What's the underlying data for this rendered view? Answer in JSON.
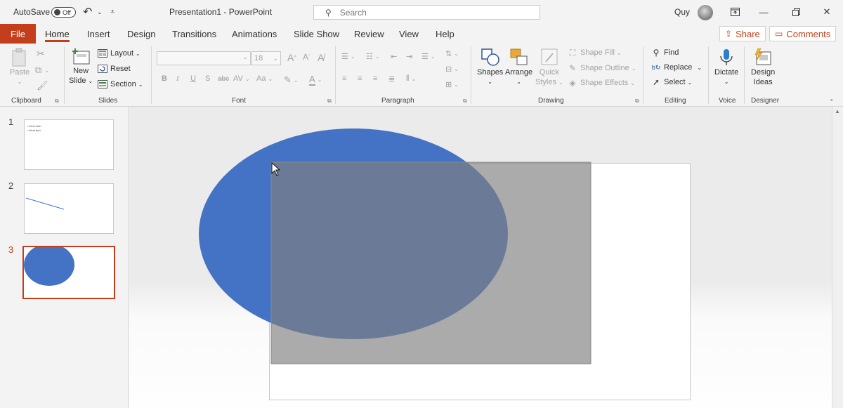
{
  "titlebar": {
    "autosave_label": "AutoSave",
    "autosave_state": "Off",
    "doc_title": "Presentation1  -  PowerPoint",
    "search_placeholder": "Search",
    "user_name": "Quy"
  },
  "tabs": {
    "file": "File",
    "items": [
      "Home",
      "Insert",
      "Design",
      "Transitions",
      "Animations",
      "Slide Show",
      "Review",
      "View",
      "Help"
    ],
    "active": "Home",
    "share_label": "Share",
    "comments_label": "Comments"
  },
  "ribbon": {
    "clipboard": {
      "label": "Clipboard",
      "paste": "Paste"
    },
    "slides": {
      "label": "Slides",
      "new_slide_1": "New",
      "new_slide_2": "Slide",
      "layout": "Layout",
      "reset": "Reset",
      "section": "Section"
    },
    "font": {
      "label": "Font",
      "font_size": "18",
      "bold": "B",
      "italic": "I",
      "underline": "U",
      "shadow": "S",
      "strike": "abc",
      "spacing": "AV",
      "case": "Aa"
    },
    "paragraph": {
      "label": "Paragraph"
    },
    "drawing": {
      "label": "Drawing",
      "shapes": "Shapes",
      "arrange": "Arrange",
      "quick_styles_1": "Quick",
      "quick_styles_2": "Styles",
      "shape_fill": "Shape Fill",
      "shape_outline": "Shape Outline",
      "shape_effects": "Shape Effects"
    },
    "editing": {
      "label": "Editing",
      "find": "Find",
      "replace": "Replace",
      "select": "Select"
    },
    "voice": {
      "label": "Voice",
      "dictate": "Dictate"
    },
    "designer": {
      "label": "Designer",
      "design_ideas_1": "Design",
      "design_ideas_2": "Ideas"
    }
  },
  "thumbnails": {
    "numbers": [
      "1",
      "2",
      "3"
    ],
    "selected": "3",
    "slide1_bullets": [
      "Khối hình",
      "Hình ảnh"
    ]
  },
  "colors": {
    "accent": "#c43e1c",
    "ellipse_fill": "#4472c4",
    "rect_fill": "#7f7f7f"
  }
}
